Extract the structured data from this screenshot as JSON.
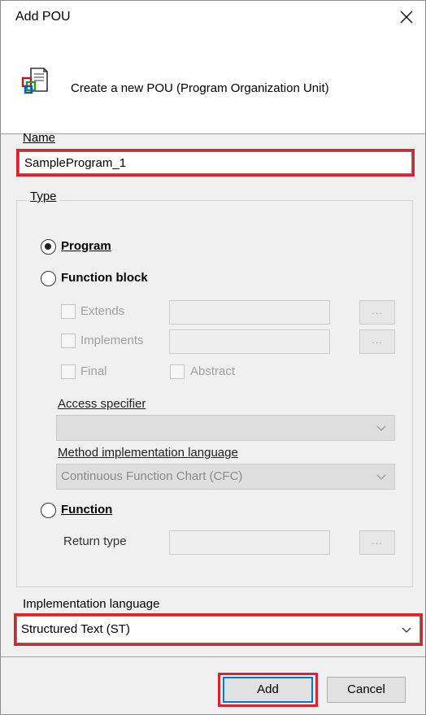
{
  "dialog": {
    "title": "Add POU",
    "description": "Create a new POU (Program Organization Unit)"
  },
  "name": {
    "label": "Name",
    "value": "SampleProgram_1"
  },
  "type": {
    "label": "Type",
    "program_label": "Program",
    "program_selected": true,
    "function_block_label": "Function block",
    "extends_label": "Extends",
    "implements_label": "Implements",
    "final_label": "Final",
    "abstract_label": "Abstract",
    "browse_label": "...",
    "access_specifier_label": "Access specifier",
    "access_specifier_value": "",
    "method_impl_label": "Method implementation language",
    "method_impl_value": "Continuous Function Chart (CFC)",
    "function_label": "Function",
    "return_type_label": "Return type"
  },
  "implementation": {
    "label": "Implementation language",
    "value": "Structured Text (ST)"
  },
  "buttons": {
    "add_label": "Add",
    "cancel_label": "Cancel"
  },
  "colors": {
    "highlight": "#e0202a",
    "focus": "#0078d7"
  }
}
